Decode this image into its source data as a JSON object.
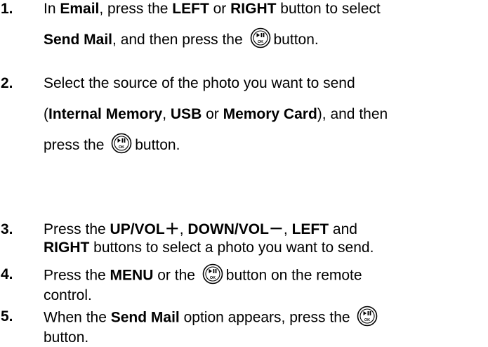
{
  "steps": [
    {
      "number": "1.",
      "lines": [
        [
          "In ",
          {
            "b": "Email"
          },
          ", press the ",
          {
            "b": "LEFT"
          },
          " or ",
          {
            "b": "RIGHT"
          },
          " button to select"
        ],
        [
          {
            "b": "Send Mail"
          },
          ", and then press the ",
          {
            "icon": "ok-play-pause-button-icon"
          },
          "button."
        ]
      ]
    },
    {
      "number": "2.",
      "lines": [
        [
          "Select the source of the photo you want to send"
        ],
        [
          "(",
          {
            "b": "Internal Memory"
          },
          ", ",
          {
            "b": "USB"
          },
          " or ",
          {
            "b": "Memory Card"
          },
          "), and then"
        ],
        [
          "press the ",
          {
            "icon": "ok-play-pause-button-icon"
          },
          "button."
        ]
      ]
    },
    {
      "number": "3.",
      "lines": [
        [
          "Press the ",
          {
            "b": "UP/VOL＋"
          },
          ", ",
          {
            "b": "DOWN/VOL－"
          },
          ", ",
          {
            "b": "LEFT"
          },
          " and"
        ],
        [
          {
            "b": "RIGHT"
          },
          " buttons to select a photo you want to send."
        ]
      ]
    },
    {
      "number": "4.",
      "lines": [
        [
          "Press the ",
          {
            "b": "MENU"
          },
          " or the ",
          {
            "icon": "ok-play-pause-button-icon"
          },
          "button on the remote"
        ],
        [
          "control."
        ]
      ]
    },
    {
      "number": "5.",
      "lines": [
        [
          "When the ",
          {
            "b": "Send Mail"
          },
          " option appears, press the ",
          {
            "icon": "ok-play-pause-button-icon"
          }
        ],
        [
          "button."
        ]
      ]
    }
  ],
  "icon_glyph_label": "OK"
}
